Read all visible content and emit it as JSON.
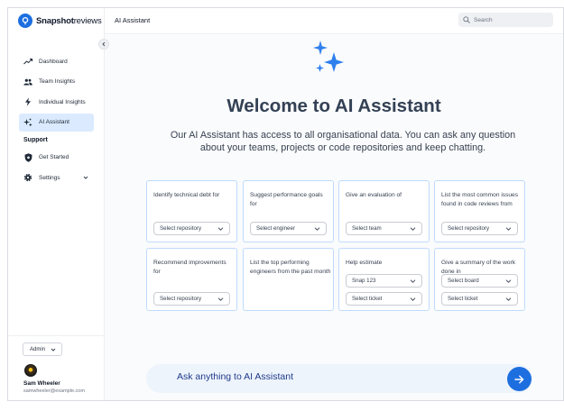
{
  "app": {
    "logo": {
      "brand_bold": "Snapshot",
      "brand_regular": "reviews"
    }
  },
  "header": {
    "title": "AI Assistant",
    "search": {
      "placeholder": "Search",
      "icon": "search-icon"
    }
  },
  "sidebar": {
    "items": [
      {
        "label": "Dashboard",
        "icon": "trend-line-icon",
        "active": false
      },
      {
        "label": "Team Insights",
        "icon": "people-icon",
        "active": false
      },
      {
        "label": "Individual Insights",
        "icon": "lightning-icon",
        "active": false
      },
      {
        "label": "AI Assistant",
        "icon": "sparkles-icon",
        "active": true
      }
    ],
    "support_heading": "Support",
    "support_items": [
      {
        "label": "Get Started",
        "icon": "shield-icon"
      },
      {
        "label": "Settings",
        "icon": "gear-icon"
      }
    ],
    "role": "Admin",
    "user": {
      "name": "Sam Wheeler",
      "email": "samwheeler@example.com"
    }
  },
  "main": {
    "title": "Welcome to AI Assistant",
    "subtitle": "Our AI Assistant has access to all organisational data. You can ask any question about your teams, projects or code repositories and keep chatting.",
    "cards": [
      {
        "text": "Identify technical debt for",
        "selects": [
          "Select repository"
        ]
      },
      {
        "text": "Suggest performance goals for",
        "selects": [
          "Select engineer"
        ]
      },
      {
        "text": "Give an evaluation of",
        "selects": [
          "Select team"
        ]
      },
      {
        "text": "List the most common issues found in code reviews from",
        "selects": [
          "Select repository"
        ]
      },
      {
        "text": "Recommend improvements for",
        "selects": [
          "Select repository"
        ]
      },
      {
        "text": "List the top performing engineers from the past month",
        "selects": []
      },
      {
        "text": "Help estimate",
        "selects": [
          "Snap 123",
          "Select ticket"
        ]
      },
      {
        "text": "Give a summary of the work done in",
        "selects": [
          "Select board",
          "Select ticket"
        ]
      }
    ],
    "ask": {
      "placeholder": "Ask anything to AI Assistant"
    }
  },
  "colors": {
    "accent": "#1d6fe0",
    "active_nav": "#dbeafe",
    "card_border": "#bfdbfe"
  }
}
